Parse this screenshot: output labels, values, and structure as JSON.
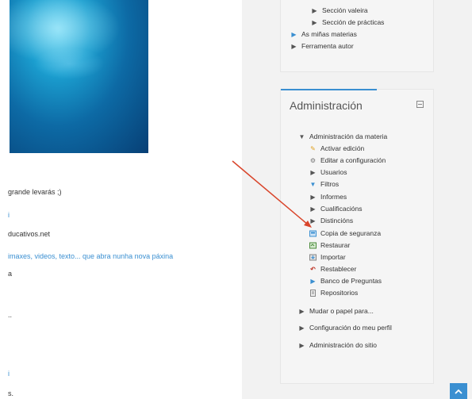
{
  "main": {
    "lines": [
      "grande levarás ;)",
      "i",
      "ducativos.net",
      "imaxes, videos, texto... que abra nunha nova páxina",
      "a",
      "..",
      "i",
      "s."
    ]
  },
  "top_block": {
    "items": [
      {
        "label": "Sección valeira",
        "link": false
      },
      {
        "label": "Sección de prácticas",
        "link": false
      },
      {
        "label": "As miñas materias",
        "link": true
      },
      {
        "label": "Ferramenta autor",
        "link": false
      }
    ]
  },
  "admin": {
    "title": "Administración",
    "items": [
      {
        "label": "Administración da materia",
        "icon": "triangle-down-icon",
        "link": false
      },
      {
        "label": "Activar edición",
        "icon": "pencil-icon",
        "link": true
      },
      {
        "label": "Editar a configuración",
        "icon": "settings-icon",
        "link": true
      },
      {
        "label": "Usuarios",
        "icon": "triangle-right-icon",
        "link": false
      },
      {
        "label": "Filtros",
        "icon": "filter-icon",
        "link": true
      },
      {
        "label": "Informes",
        "icon": "triangle-right-icon",
        "link": false
      },
      {
        "label": "Cualificacións",
        "icon": "triangle-right-icon",
        "link": false
      },
      {
        "label": "Distincións",
        "icon": "triangle-right-icon",
        "link": false
      },
      {
        "label": "Copia de seguranza",
        "icon": "backup-icon",
        "link": true
      },
      {
        "label": "Restaurar",
        "icon": "restore-icon",
        "link": true
      },
      {
        "label": "Importar",
        "icon": "import-icon",
        "link": true
      },
      {
        "label": "Restablecer",
        "icon": "reset-icon",
        "link": true
      },
      {
        "label": "Banco de Preguntas",
        "icon": "triangle-right-icon",
        "link": true
      },
      {
        "label": "Repositorios",
        "icon": "repository-icon",
        "link": true
      }
    ],
    "bottom_items": [
      {
        "label": "Mudar o papel para...",
        "icon": "triangle-right-icon"
      },
      {
        "label": "Configuración do meu perfil",
        "icon": "triangle-right-icon"
      },
      {
        "label": "Administración do sitio",
        "icon": "triangle-right-icon"
      }
    ]
  },
  "colors": {
    "link": "#3a8fd1",
    "accent_bar": "#3a8fd1",
    "arrow": "#d9452b"
  }
}
